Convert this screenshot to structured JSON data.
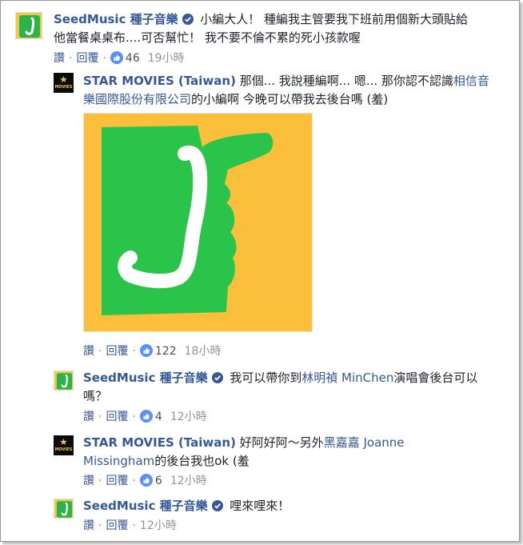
{
  "comments": [
    {
      "author": "SeedMusic 種子音樂",
      "text": "小編大人！ 種編我主管要我下班前用個新大頭貼給他當餐桌桌布....可否幫忙！ 我不要不倫不累的死小孩款喔",
      "like_label": "讚",
      "reply_label": "回覆",
      "likes": "46",
      "time": "19小時"
    },
    {
      "author": "STAR MOVIES (Taiwan)",
      "text_before": "那個... 我說種編啊... 嗯... 那你認不認識",
      "link": "相信音樂國際股份有限公司",
      "text_after": "的小編啊 今晚可以帶我去後台嗎 (羞)",
      "like_label": "讚",
      "reply_label": "回覆",
      "likes": "122",
      "time": "18小時"
    },
    {
      "author": "SeedMusic 種子音樂",
      "text_before": "我可以帶你到",
      "link": "林明禎 MinChen",
      "text_after": "演唱會後台可以嗎？",
      "like_label": "讚",
      "reply_label": "回覆",
      "likes": "4",
      "time": "12小時"
    },
    {
      "author": "STAR MOVIES (Taiwan)",
      "text_before": "好阿好阿～另外",
      "link": "黑嘉嘉 Joanne Missingham",
      "text_after": "的後台我也ok (羞",
      "like_label": "讚",
      "reply_label": "回覆",
      "likes": "6",
      "time": "12小時"
    },
    {
      "author": "SeedMusic 種子音樂",
      "text": "哩來哩來！",
      "like_label": "讚",
      "reply_label": "回覆",
      "time": "12小時"
    }
  ],
  "star_logo_text": "MOVIES",
  "colors": {
    "link": "#365899",
    "seed_green": "#2db34a",
    "seed_yellow": "#f5c842",
    "photo_bg": "#fbbf3c",
    "photo_green": "#2ac44a"
  }
}
